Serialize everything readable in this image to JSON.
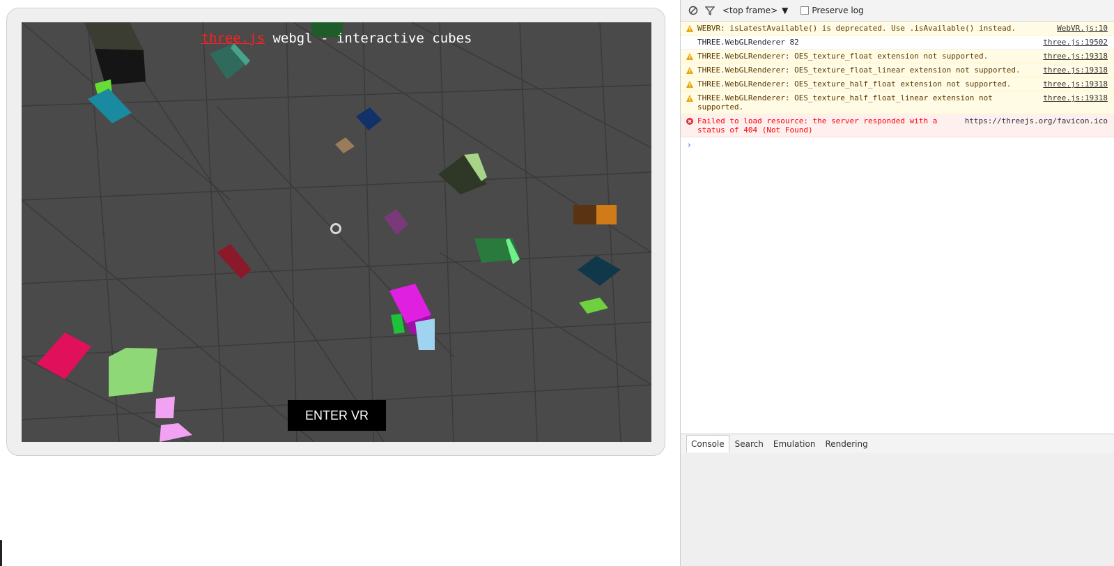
{
  "scene": {
    "info_link": "three.js",
    "info_text": " webgl - interactive cubes",
    "enter_vr_label": "ENTER VR",
    "background_color": "#4a4a4a",
    "grid_color": "#3a3a3a"
  },
  "devtools": {
    "toolbar": {
      "clear_icon": "clear-console-icon",
      "filter_icon": "filter-icon",
      "frame_select": "<top frame>",
      "preserve_log_label": "Preserve log"
    },
    "messages": [
      {
        "level": "warning",
        "text": "WEBVR: isLatestAvailable() is deprecated. Use .isAvailable() instead.",
        "source": "WebVR.js:10"
      },
      {
        "level": "info",
        "text": "THREE.WebGLRenderer 82",
        "source": "three.js:19502"
      },
      {
        "level": "warning",
        "text": "THREE.WebGLRenderer: OES_texture_float extension not supported.",
        "source": "three.js:19318"
      },
      {
        "level": "warning",
        "text": "THREE.WebGLRenderer: OES_texture_float_linear extension not supported.",
        "source": "three.js:19318"
      },
      {
        "level": "warning",
        "text": "THREE.WebGLRenderer: OES_texture_half_float extension not supported.",
        "source": "three.js:19318"
      },
      {
        "level": "warning",
        "text": "THREE.WebGLRenderer: OES_texture_half_float_linear extension not supported.",
        "source": "three.js:19318"
      },
      {
        "level": "error",
        "text": "Failed to load resource: the server responded with a status of 404 (Not Found)",
        "source": "https://threejs.org/favicon.ico"
      }
    ],
    "prompt_symbol": "›",
    "tabs": [
      "Console",
      "Search",
      "Emulation",
      "Rendering"
    ],
    "active_tab": "Console"
  }
}
